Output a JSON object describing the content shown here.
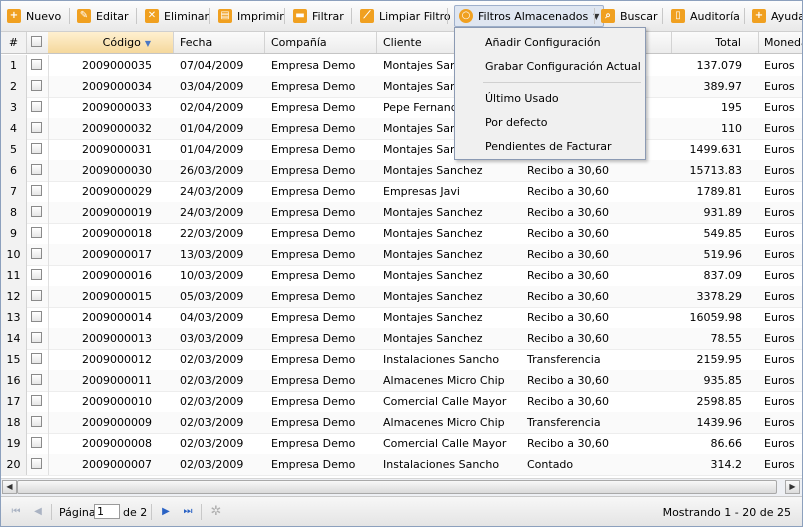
{
  "toolbar": {
    "new_label": "Nuevo",
    "edit_label": "Editar",
    "delete_label": "Eliminar",
    "print_label": "Imprimir",
    "filter_label": "Filtrar",
    "clear_filter_label": "Limpiar Filtro",
    "stored_filters_label": "Filtros Almacenados",
    "search_label": "Buscar",
    "audit_label": "Auditoría",
    "help_label": "Ayuda"
  },
  "menu": {
    "items": [
      "Añadir Configuración",
      "Grabar Configuración Actual",
      "Último Usado",
      "Por defecto",
      "Pendientes de Facturar"
    ]
  },
  "grid": {
    "headers": {
      "num": "#",
      "codigo": "Código",
      "fecha": "Fecha",
      "compania": "Compañía",
      "cliente": "Cliente",
      "forma_pago": "",
      "total": "Total",
      "moneda": "Moneda"
    },
    "rows": [
      {
        "n": "1",
        "codigo": "2009000035",
        "fecha": "07/04/2009",
        "compania": "Empresa Demo",
        "cliente": "Montajes Sanchez",
        "pago": "",
        "total": "137.079",
        "moneda": "Euros"
      },
      {
        "n": "2",
        "codigo": "2009000034",
        "fecha": "03/04/2009",
        "compania": "Empresa Demo",
        "cliente": "Montajes Sanchez",
        "pago": "",
        "total": "389.97",
        "moneda": "Euros"
      },
      {
        "n": "3",
        "codigo": "2009000033",
        "fecha": "02/04/2009",
        "compania": "Empresa Demo",
        "cliente": "Pepe Fernandez",
        "pago": "",
        "total": "195",
        "moneda": "Euros"
      },
      {
        "n": "4",
        "codigo": "2009000032",
        "fecha": "01/04/2009",
        "compania": "Empresa Demo",
        "cliente": "Montajes Sanchez",
        "pago": "",
        "total": "110",
        "moneda": "Euros"
      },
      {
        "n": "5",
        "codigo": "2009000031",
        "fecha": "01/04/2009",
        "compania": "Empresa Demo",
        "cliente": "Montajes Sanchez",
        "pago": "",
        "total": "1499.631",
        "moneda": "Euros"
      },
      {
        "n": "6",
        "codigo": "2009000030",
        "fecha": "26/03/2009",
        "compania": "Empresa Demo",
        "cliente": "Montajes Sanchez",
        "pago": "Recibo a 30,60",
        "total": "15713.83",
        "moneda": "Euros"
      },
      {
        "n": "7",
        "codigo": "2009000029",
        "fecha": "24/03/2009",
        "compania": "Empresa Demo",
        "cliente": "Empresas Javi",
        "pago": "Recibo a 30,60",
        "total": "1789.81",
        "moneda": "Euros"
      },
      {
        "n": "8",
        "codigo": "2009000019",
        "fecha": "24/03/2009",
        "compania": "Empresa Demo",
        "cliente": "Montajes Sanchez",
        "pago": "Recibo a 30,60",
        "total": "931.89",
        "moneda": "Euros"
      },
      {
        "n": "9",
        "codigo": "2009000018",
        "fecha": "22/03/2009",
        "compania": "Empresa Demo",
        "cliente": "Montajes Sanchez",
        "pago": "Recibo a 30,60",
        "total": "549.85",
        "moneda": "Euros"
      },
      {
        "n": "10",
        "codigo": "2009000017",
        "fecha": "13/03/2009",
        "compania": "Empresa Demo",
        "cliente": "Montajes Sanchez",
        "pago": "Recibo a 30,60",
        "total": "519.96",
        "moneda": "Euros"
      },
      {
        "n": "11",
        "codigo": "2009000016",
        "fecha": "10/03/2009",
        "compania": "Empresa Demo",
        "cliente": "Montajes Sanchez",
        "pago": "Recibo a 30,60",
        "total": "837.09",
        "moneda": "Euros"
      },
      {
        "n": "12",
        "codigo": "2009000015",
        "fecha": "05/03/2009",
        "compania": "Empresa Demo",
        "cliente": "Montajes Sanchez",
        "pago": "Recibo a 30,60",
        "total": "3378.29",
        "moneda": "Euros"
      },
      {
        "n": "13",
        "codigo": "2009000014",
        "fecha": "04/03/2009",
        "compania": "Empresa Demo",
        "cliente": "Montajes Sanchez",
        "pago": "Recibo a 30,60",
        "total": "16059.98",
        "moneda": "Euros"
      },
      {
        "n": "14",
        "codigo": "2009000013",
        "fecha": "03/03/2009",
        "compania": "Empresa Demo",
        "cliente": "Montajes Sanchez",
        "pago": "Recibo a 30,60",
        "total": "78.55",
        "moneda": "Euros"
      },
      {
        "n": "15",
        "codigo": "2009000012",
        "fecha": "02/03/2009",
        "compania": "Empresa Demo",
        "cliente": "Instalaciones Sancho",
        "pago": "Transferencia",
        "total": "2159.95",
        "moneda": "Euros"
      },
      {
        "n": "16",
        "codigo": "2009000011",
        "fecha": "02/03/2009",
        "compania": "Empresa Demo",
        "cliente": "Almacenes Micro Chip",
        "pago": "Recibo a 30,60",
        "total": "935.85",
        "moneda": "Euros"
      },
      {
        "n": "17",
        "codigo": "2009000010",
        "fecha": "02/03/2009",
        "compania": "Empresa Demo",
        "cliente": "Comercial Calle Mayor",
        "pago": "Recibo a 30,60",
        "total": "2598.85",
        "moneda": "Euros"
      },
      {
        "n": "18",
        "codigo": "2009000009",
        "fecha": "02/03/2009",
        "compania": "Empresa Demo",
        "cliente": "Almacenes Micro Chip",
        "pago": "Transferencia",
        "total": "1439.96",
        "moneda": "Euros"
      },
      {
        "n": "19",
        "codigo": "2009000008",
        "fecha": "02/03/2009",
        "compania": "Empresa Demo",
        "cliente": "Comercial Calle Mayor",
        "pago": "Recibo a 30,60",
        "total": "86.66",
        "moneda": "Euros"
      },
      {
        "n": "20",
        "codigo": "2009000007",
        "fecha": "02/03/2009",
        "compania": "Empresa Demo",
        "cliente": "Instalaciones Sancho",
        "pago": "Contado",
        "total": "314.2",
        "moneda": "Euros"
      }
    ]
  },
  "paging": {
    "page_label": "Página",
    "page_value": "1",
    "of_label": "de 2",
    "status": "Mostrando 1 - 20 de 25"
  },
  "colors": {
    "accent": "#4b78c4",
    "toolbar_icon": "#f0a020",
    "sort_header": "#f5d89c"
  },
  "icons": [
    "plus-icon",
    "edit-icon",
    "delete-icon",
    "print-icon",
    "filter-icon",
    "clear-filter-icon",
    "stored-filters-icon",
    "search-icon",
    "audit-icon",
    "help-icon",
    "refresh-icon"
  ]
}
